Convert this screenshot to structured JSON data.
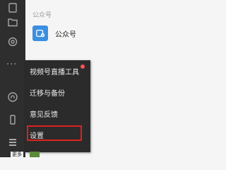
{
  "sidebar": {
    "icons": [
      {
        "name": "file-icon"
      },
      {
        "name": "folder-icon"
      },
      {
        "name": "settings-icon"
      },
      {
        "name": "more-dots-icon"
      },
      {
        "name": "mini-program-icon"
      },
      {
        "name": "phone-icon"
      },
      {
        "name": "menu-icon"
      }
    ],
    "more_label": "更多"
  },
  "main": {
    "section_header": "公众号",
    "official_account_label": "公众号"
  },
  "menu": {
    "items": [
      {
        "label": "视频号直播工具",
        "has_dot": true
      },
      {
        "label": "迁移与备份"
      },
      {
        "label": "意见反馈"
      },
      {
        "label": "设置"
      }
    ]
  },
  "colors": {
    "sidebar_bg": "#2e2e2e",
    "menu_bg": "#2b2b2b",
    "highlight_border": "#e02020",
    "badge": "#fa5151",
    "oa_icon": "#3a8fe0"
  }
}
